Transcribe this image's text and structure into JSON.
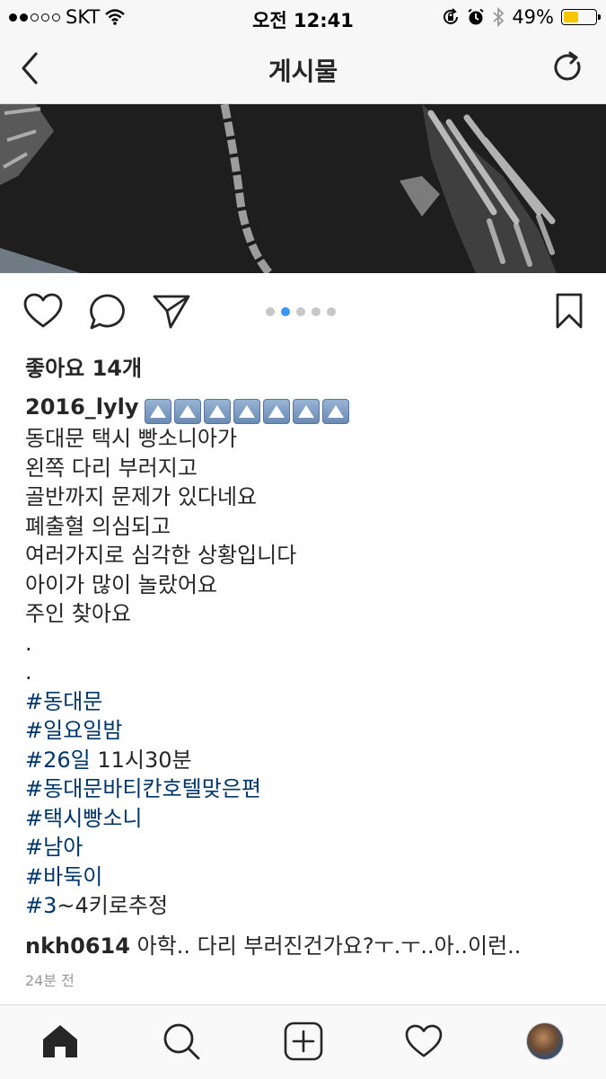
{
  "status_bar": {
    "carrier": "SKT",
    "time": "오전 12:41",
    "battery": "49%",
    "battery_level": 0.49,
    "icons": [
      "signal-dots-icon",
      "wifi-icon",
      "rotation-lock-icon",
      "alarm-icon",
      "bluetooth-icon",
      "battery-icon"
    ]
  },
  "nav": {
    "title": "게시물",
    "back_icon": "chevron-left-icon",
    "refresh_icon": "refresh-icon"
  },
  "post": {
    "likes": "좋아요 14개",
    "carousel": {
      "count": 5,
      "active_index": 1
    },
    "actions": [
      "heart-icon",
      "comment-icon",
      "share-icon",
      "bookmark-icon"
    ],
    "caption": {
      "username": "2016_lyly",
      "emoji_count": 7,
      "lines": [
        "동대문 택시 빵소니아가",
        "왼쪽 다리 부러지고",
        "골반까지 문제가 있다네요",
        "폐출혈 의심되고",
        "여러가지로 심각한 상황입니다",
        "아이가 많이 놀랐어요",
        "주인 찾아요",
        ".",
        "."
      ],
      "hashtags": [
        {
          "tag": "#동대문",
          "rest": ""
        },
        {
          "tag": "#일요일밤",
          "rest": ""
        },
        {
          "tag": "#26일",
          "rest": " 11시30분"
        },
        {
          "tag": "#동대문바티칸호텔맞은편",
          "rest": ""
        },
        {
          "tag": "#택시빵소니",
          "rest": ""
        },
        {
          "tag": "#남아",
          "rest": ""
        },
        {
          "tag": "#바둑이",
          "rest": ""
        },
        {
          "tag": "#3",
          "rest": "~4키로추정"
        }
      ]
    },
    "comment": {
      "username": "nkh0614",
      "text": " 아학.. 다리 부러진건가요?ㅜ.ㅜ..아..이런.."
    },
    "timestamp": "24분 전"
  },
  "tab_bar": {
    "items": [
      "home-icon",
      "search-icon",
      "add-icon",
      "activity-heart-icon",
      "profile-avatar"
    ],
    "active": "home-icon"
  }
}
